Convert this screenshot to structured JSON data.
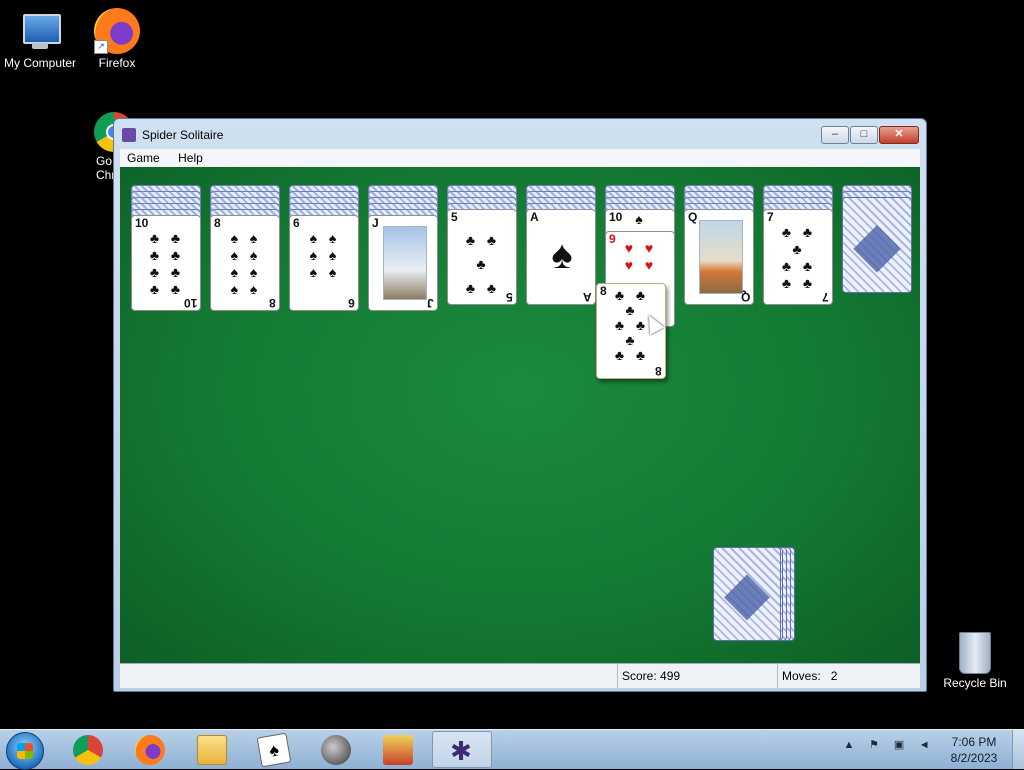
{
  "desktop": {
    "icons": [
      {
        "label": "My Computer"
      },
      {
        "label": "Firefox"
      },
      {
        "label": "Go\nChr"
      }
    ],
    "recycle_bin": {
      "label": "Recycle Bin"
    }
  },
  "window": {
    "title": "Spider Solitaire",
    "menu": [
      "Game",
      "Help"
    ],
    "controls": {
      "minimize": "–",
      "maximize": "□",
      "close": "✕"
    }
  },
  "tableau": [
    {
      "rank": "10",
      "suit": "♣",
      "color": "black",
      "pips": "♣ ♣\n♣ ♣\n♣ ♣\n♣ ♣"
    },
    {
      "rank": "8",
      "suit": "♠",
      "color": "black",
      "pips": "♠ ♠\n♠ ♠\n♠ ♠\n♠ ♠"
    },
    {
      "rank": "6",
      "suit": "♠",
      "color": "black",
      "pips": "♠ ♠\n♠ ♠\n♠ ♠"
    },
    {
      "rank": "J",
      "suit": "♠",
      "color": "black",
      "face": true
    },
    {
      "rank": "5",
      "suit": "♣",
      "color": "black",
      "pips": "♣ ♣\n♣\n♣ ♣"
    },
    {
      "rank": "A",
      "suit": "♠",
      "color": "black",
      "ace": true
    },
    {
      "rank": "9",
      "suit": "♥",
      "color": "red",
      "pips": "♥ ♥\n♥ ♥",
      "above_rank": "10",
      "above_suit": "♠"
    },
    {
      "rank": "Q",
      "suit": "♣",
      "color": "black",
      "face": true
    },
    {
      "rank": "7",
      "suit": "♣",
      "color": "black",
      "pips": "♣ ♣\n♣\n♣ ♣\n♣ ♣"
    },
    {
      "rank": "",
      "suit": "",
      "color": "black",
      "back": true
    }
  ],
  "dragging_card": {
    "rank": "8",
    "suit": "♣",
    "pips": "♣ ♣\n♣\n♣ ♣\n♣\n♣ ♣"
  },
  "status": {
    "score_label": "Score:",
    "score_value": "499",
    "moves_label": "Moves:",
    "moves_value": "2"
  },
  "taskbar": {
    "apps": [
      "chrome-icon",
      "firefox-icon",
      "folder-icon",
      "solitaire-icon",
      "minesweeper-icon",
      "hearts-icon",
      "spider-solitaire-icon"
    ],
    "time": "7:06 PM",
    "date": "8/2/2023"
  },
  "colors": {
    "felt": "#147a33",
    "card_back": "#4d63a8",
    "red_suit": "#dd1111"
  }
}
